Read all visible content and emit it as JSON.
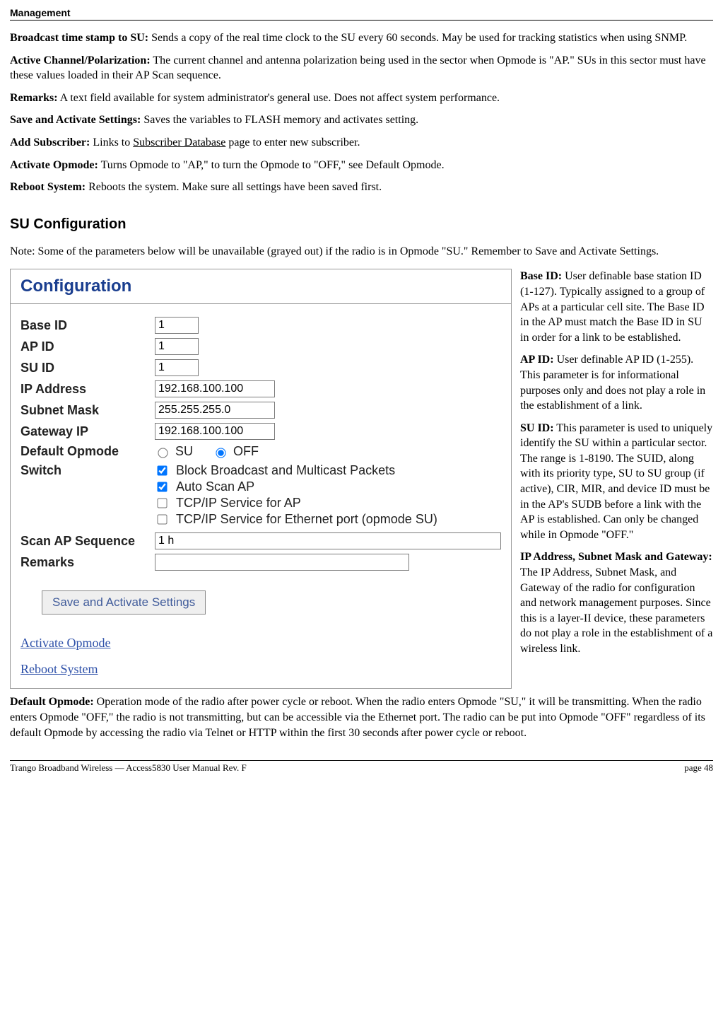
{
  "header": {
    "running": "Management"
  },
  "top_defs": [
    {
      "term": "Broadcast time stamp to SU:",
      "text": "  Sends a copy of the real time clock to the SU every 60 seconds. May be used for tracking statistics when using SNMP."
    },
    {
      "term": "Active Channel/Polarization:",
      "text": " The current channel and antenna polarization being used in the sector when Opmode is \"AP.\" SUs in this sector must have these values loaded in their AP Scan sequence."
    },
    {
      "term": "Remarks:",
      "text": " A text field available for system administrator's general use.  Does not affect system performance."
    },
    {
      "term": "Save and Activate Settings:",
      "text": " Saves the variables to FLASH memory and activates setting."
    },
    {
      "term": "Add Subscriber:",
      "pre": " Links to ",
      "link": "Subscriber Database",
      "post": " page to enter new subscriber."
    },
    {
      "term": "Activate Opmode:",
      "text": " Turns Opmode to \"AP,\" to turn the Opmode to \"OFF,\" see Default Opmode."
    },
    {
      "term": "Reboot System:",
      "text": " Reboots the system.  Make sure all settings have been saved first."
    }
  ],
  "section_title": "SU Configuration",
  "note": "Note:  Some of the parameters below will be unavailable (grayed out) if the radio is in Opmode \"SU.\"  Remember to Save and Activate Settings.",
  "panel": {
    "title": "Configuration",
    "base_id": {
      "label": "Base ID",
      "value": "1"
    },
    "ap_id": {
      "label": "AP ID",
      "value": "1"
    },
    "su_id": {
      "label": "SU ID",
      "value": "1"
    },
    "ip": {
      "label": "IP Address",
      "value": "192.168.100.100"
    },
    "subnet": {
      "label": "Subnet Mask",
      "value": "255.255.255.0"
    },
    "gateway": {
      "label": "Gateway IP",
      "value": "192.168.100.100"
    },
    "opmode": {
      "label": "Default Opmode",
      "su": "SU",
      "off": "OFF"
    },
    "switch": {
      "label": "Switch",
      "items": [
        {
          "label": "Block Broadcast and Multicast Packets",
          "checked": true
        },
        {
          "label": "Auto Scan AP",
          "checked": true
        },
        {
          "label": "TCP/IP Service for AP",
          "checked": false
        },
        {
          "label": "TCP/IP Service for Ethernet port (opmode SU)",
          "checked": false
        }
      ]
    },
    "scan": {
      "label": "Scan AP Sequence",
      "value": "1 h"
    },
    "remarks": {
      "label": "Remarks",
      "value": ""
    },
    "save_btn": "Save and Activate Settings",
    "links": {
      "activate": "Activate Opmode",
      "reboot": "Reboot System"
    }
  },
  "side": [
    {
      "term": "Base ID:",
      "text": "  User definable base station ID (1-127).  Typically assigned to a group of APs at a particular cell site.  The Base ID in the AP must match the Base ID in SU in order for a link to be established."
    },
    {
      "term": "AP ID:",
      "text": "  User definable AP ID (1-255).  This parameter is for informational purposes only and does not play a role in the establishment of a link."
    },
    {
      "term": "SU ID:",
      "text": "  This parameter is used to uniquely identify the SU within a particular sector.  The range is 1-8190.  The SUID, along with its priority type, SU to SU group (if active), CIR, MIR, and device ID must be in the AP's SUDB before a link with the AP is established.  Can only be changed while in Opmode \"OFF.\""
    },
    {
      "term": "IP Address, Subnet Mask and Gateway:",
      "text": "  The IP Address, Subnet Mask, and Gateway of the radio for configuration and network management purposes.  Since this is a layer-II device, these parameters do not play a role in the establishment of a wireless link."
    }
  ],
  "after_def": {
    "term": "Default Opmode:",
    "text": " Operation mode of the radio after power cycle or reboot.  When the radio enters Opmode \"SU,\" it will be transmitting.  When the radio enters Opmode \"OFF,\" the radio is not transmitting, but can be accessible via the Ethernet port.  The radio can be put into Opmode \"OFF\" regardless of its default Opmode by accessing the radio via Telnet or HTTP within the first 30 seconds after power cycle or reboot."
  },
  "footer": {
    "left": "Trango Broadband Wireless — Access5830 User Manual  Rev. F",
    "right": "page 48"
  }
}
